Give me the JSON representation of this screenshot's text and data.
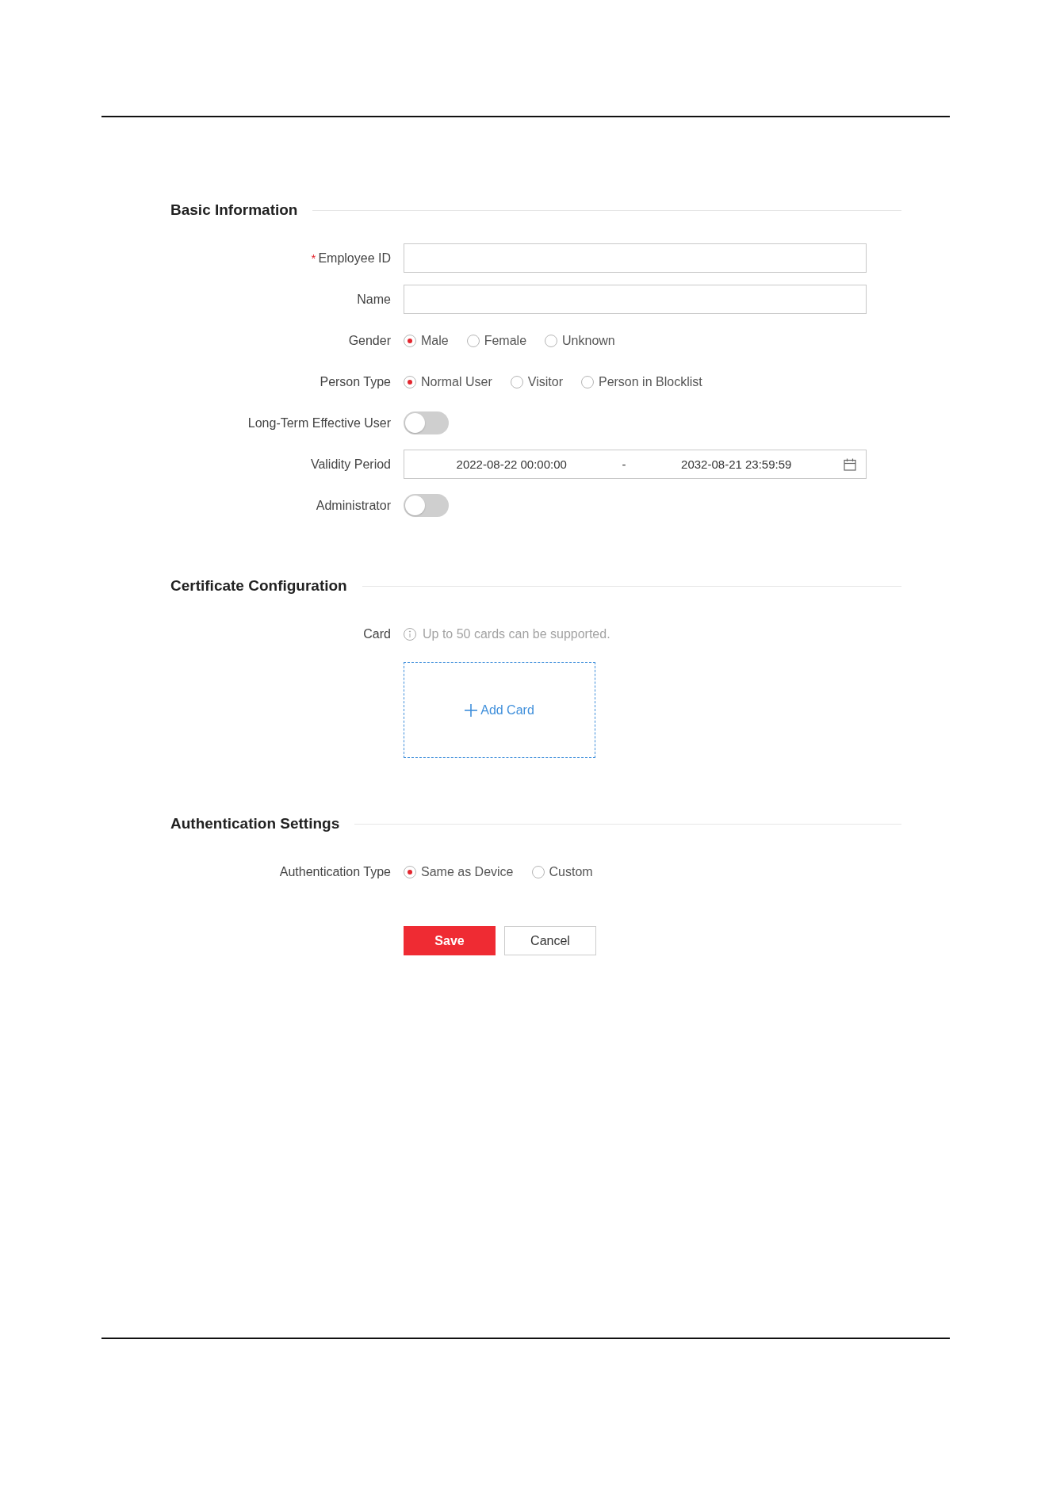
{
  "sections": [
    {
      "title": "Basic Information",
      "fields": [
        {
          "kind": "text",
          "label": "Employee ID",
          "required_mark": "*"
        },
        {
          "kind": "text",
          "label": "Name"
        },
        {
          "kind": "radio",
          "label": "Gender",
          "options": [
            {
              "label": "Male",
              "selected": true
            },
            {
              "label": "Female",
              "selected": false
            },
            {
              "label": "Unknown",
              "selected": false
            }
          ]
        },
        {
          "kind": "radio",
          "label": "Person Type",
          "options": [
            {
              "label": "Normal User",
              "selected": true
            },
            {
              "label": "Visitor",
              "selected": false
            },
            {
              "label": "Person in Blocklist",
              "selected": false
            }
          ]
        },
        {
          "kind": "toggle",
          "label": "Long-Term Effective User",
          "on": false
        },
        {
          "kind": "date_range",
          "label": "Validity Period",
          "start": "2022-08-22 00:00:00",
          "separator": "-",
          "end": "2032-08-21 23:59:59"
        },
        {
          "kind": "toggle",
          "label": "Administrator",
          "on": false
        }
      ]
    },
    {
      "title": "Certificate Configuration",
      "fields": [
        {
          "kind": "card",
          "label": "Card",
          "hint": "Up to 50 cards can be supported.",
          "add_label": "Add Card"
        }
      ]
    },
    {
      "title": "Authentication Settings",
      "fields": [
        {
          "kind": "radio",
          "label": "Authentication Type",
          "options": [
            {
              "label": "Same as Device",
              "selected": true
            },
            {
              "label": "Custom",
              "selected": false
            }
          ]
        }
      ]
    }
  ],
  "buttons": [
    {
      "kind": "primary",
      "label": "Save"
    },
    {
      "kind": "secondary",
      "label": "Cancel"
    }
  ]
}
